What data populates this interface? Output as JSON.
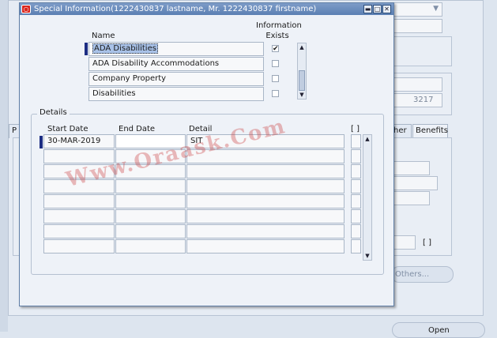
{
  "window": {
    "title": "Special Information(1222430837 lastname, Mr. 1222430837 firstname)",
    "buttons": [
      "minimize-icon",
      "maximize-icon",
      "close-icon"
    ]
  },
  "special_info": {
    "name_header": "Name",
    "exists_header": "Information Exists",
    "rows": [
      {
        "name": "ADA Disabilities",
        "exists": "✔"
      },
      {
        "name": "ADA Disability Accommodations",
        "exists": ""
      },
      {
        "name": "Company Property",
        "exists": ""
      },
      {
        "name": "Disabilities",
        "exists": ""
      }
    ]
  },
  "details": {
    "label": "Details",
    "columns": {
      "start_date": "Start Date",
      "end_date": "End Date",
      "detail": "Detail",
      "flex": "[ ]"
    },
    "rows": [
      {
        "start_date": "30-MAR-2019",
        "end_date": "",
        "detail": "SIT"
      },
      {
        "start_date": "",
        "end_date": "",
        "detail": ""
      },
      {
        "start_date": "",
        "end_date": "",
        "detail": ""
      },
      {
        "start_date": "",
        "end_date": "",
        "detail": ""
      },
      {
        "start_date": "",
        "end_date": "",
        "detail": ""
      },
      {
        "start_date": "",
        "end_date": "",
        "detail": ""
      },
      {
        "start_date": "",
        "end_date": "",
        "detail": ""
      },
      {
        "start_date": "",
        "end_date": "",
        "detail": ""
      }
    ]
  },
  "background": {
    "tab_partial": "P",
    "tab_other": "her",
    "tab_benefits": "Benefits",
    "id_partial": "3217",
    "others_button": "Others...",
    "open_button": "Open",
    "flex_bracket": "[ ]"
  },
  "watermark": "Www.Oraask.Com"
}
